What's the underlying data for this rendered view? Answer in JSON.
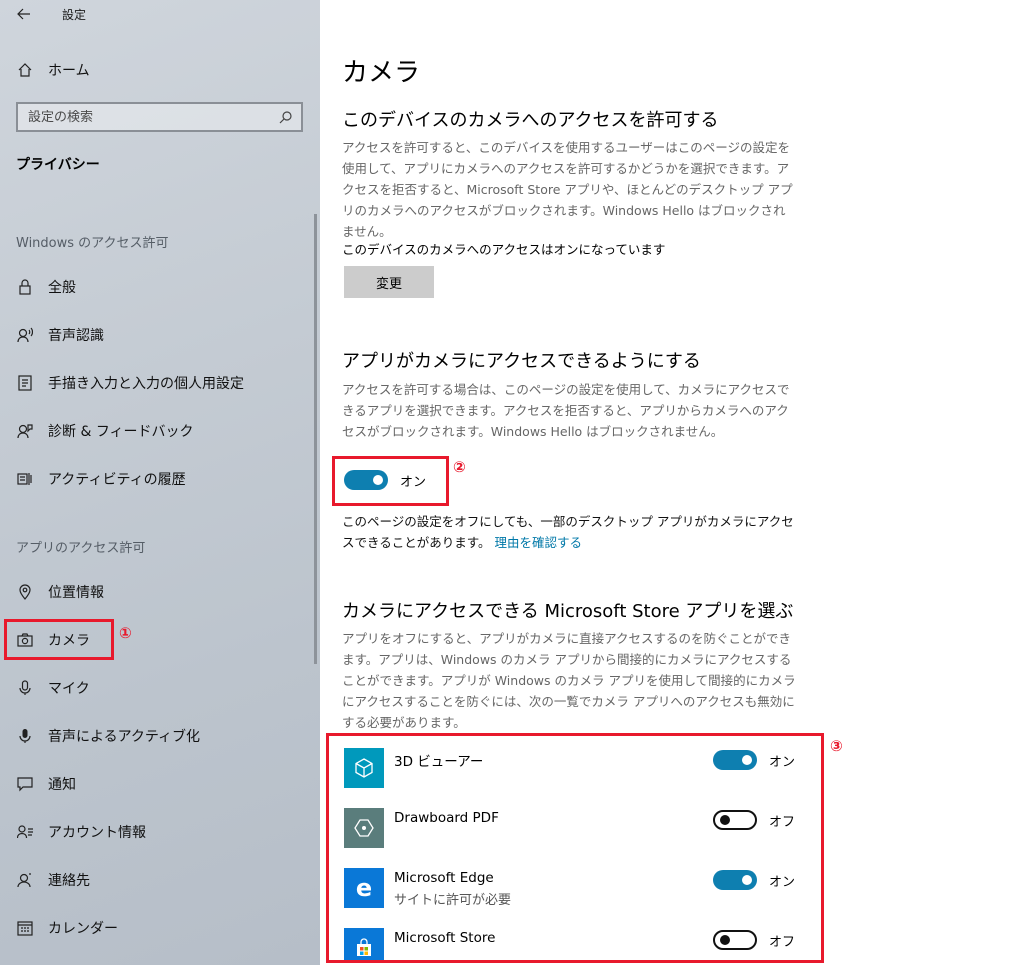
{
  "window": {
    "title": "設定"
  },
  "sidebar": {
    "home_label": "ホーム",
    "search_placeholder": "設定の検索",
    "section_title": "プライバシー",
    "group_windows": "Windows のアクセス許可",
    "windows_items": [
      {
        "label": "全般",
        "icon": "lock-icon"
      },
      {
        "label": "音声認識",
        "icon": "speech-icon"
      },
      {
        "label": "手描き入力と入力の個人用設定",
        "icon": "inking-icon"
      },
      {
        "label": "診断 & フィードバック",
        "icon": "feedback-icon"
      },
      {
        "label": "アクティビティの履歴",
        "icon": "activity-icon"
      }
    ],
    "group_apps": "アプリのアクセス許可",
    "app_items": [
      {
        "label": "位置情報",
        "icon": "location-icon"
      },
      {
        "label": "カメラ",
        "icon": "camera-icon",
        "selected": true
      },
      {
        "label": "マイク",
        "icon": "microphone-icon"
      },
      {
        "label": "音声によるアクティブ化",
        "icon": "voice-activation-icon"
      },
      {
        "label": "通知",
        "icon": "notification-icon"
      },
      {
        "label": "アカウント情報",
        "icon": "account-info-icon"
      },
      {
        "label": "連絡先",
        "icon": "contacts-icon"
      },
      {
        "label": "カレンダー",
        "icon": "calendar-icon"
      }
    ]
  },
  "main": {
    "page_title": "カメラ",
    "device_section": {
      "heading": "このデバイスのカメラへのアクセスを許可する",
      "description": "アクセスを許可すると、このデバイスを使用するユーザーはこのページの設定を使用して、アプリにカメラへのアクセスを許可するかどうかを選択できます。アクセスを拒否すると、Microsoft Store アプリや、ほとんどのデスクトップ アプリのカメラへのアクセスがブロックされます。Windows Hello はブロックされません。",
      "status": "このデバイスのカメラへのアクセスはオンになっています",
      "change_button": "変更"
    },
    "apps_section": {
      "heading": "アプリがカメラにアクセスできるようにする",
      "description": "アクセスを許可する場合は、このページの設定を使用して、カメラにアクセスできるアプリを選択できます。アクセスを拒否すると、アプリからカメラへのアクセスがブロックされます。Windows Hello はブロックされません。",
      "toggle_label": "オン",
      "note": "このページの設定をオフにしても、一部のデスクトップ アプリがカメラにアクセスできることがあります。",
      "note_link": "理由を確認する"
    },
    "store_section": {
      "heading": "カメラにアクセスできる Microsoft Store アプリを選ぶ",
      "description": "アプリをオフにすると、アプリがカメラに直接アクセスするのを防ぐことができます。アプリは、Windows のカメラ アプリから間接的にカメラにアクセスすることができます。アプリが Windows のカメラ アプリを使用して間接的にカメラにアクセスすることを防ぐには、次の一覧でカメラ アプリへのアクセスも無効にする必要があります。",
      "apps": [
        {
          "name": "3D ビューアー",
          "subtitle": "",
          "state": "オン",
          "on": true,
          "icon": "3d-viewer-icon",
          "color": "#0099bc"
        },
        {
          "name": "Drawboard PDF",
          "subtitle": "",
          "state": "オフ",
          "on": false,
          "icon": "drawboard-pdf-icon",
          "color": "#5a7d7c"
        },
        {
          "name": "Microsoft Edge",
          "subtitle": "サイトに許可が必要",
          "state": "オン",
          "on": true,
          "icon": "edge-icon",
          "color": "#0a78d7"
        },
        {
          "name": "Microsoft Store",
          "subtitle": "",
          "state": "オフ",
          "on": false,
          "icon": "store-icon",
          "color": "#0a78d7"
        }
      ]
    }
  },
  "annotations": {
    "one": "①",
    "two": "②",
    "three": "③"
  },
  "colors": {
    "accent": "#0e7fb0",
    "annotation": "#e8192c",
    "link": "#0078a8"
  }
}
